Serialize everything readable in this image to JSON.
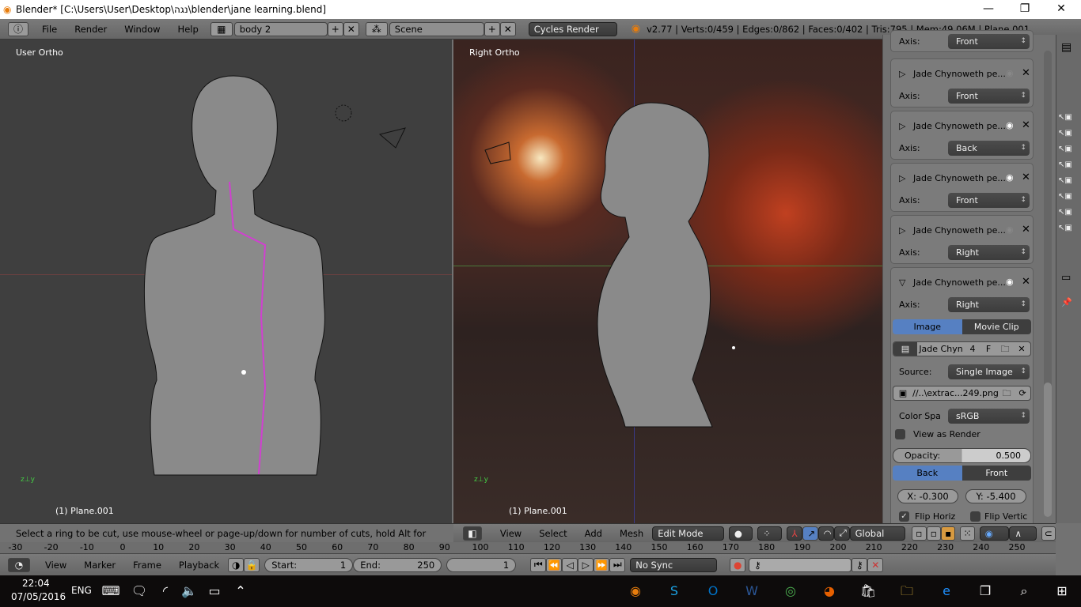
{
  "window": {
    "title": "Blender* [C:\\Users\\User\\Desktop\\נגה\\blender\\jane learning.blend]",
    "minimize": "—",
    "maximize": "❐",
    "close": "✕"
  },
  "header": {
    "menus": [
      "File",
      "Render",
      "Window",
      "Help"
    ],
    "screen": "body 2",
    "scene": "Scene",
    "engine": "Cycles Render",
    "stats": "v2.77 | Verts:0/459 | Edges:0/862 | Faces:0/402 | Tris:795 | Mem:49.06M | Plane.001"
  },
  "viewport_left": {
    "label": "User Ortho",
    "object": "(1) Plane.001"
  },
  "viewport_right": {
    "label": "Right Ortho",
    "object": "(1) Plane.001"
  },
  "properties": {
    "axis_label": "Axis:",
    "top_axis": "Front",
    "backgrounds": [
      {
        "name": "Jade Chynoweth pe...",
        "axis": "Front",
        "visible": false,
        "expanded": false
      },
      {
        "name": "Jade Chynoweth pe...",
        "axis": "Back",
        "visible": true,
        "expanded": false
      },
      {
        "name": "Jade Chynoweth pe...",
        "axis": "Front",
        "visible": true,
        "expanded": false
      },
      {
        "name": "Jade Chynoweth pe...",
        "axis": "Right",
        "visible": false,
        "expanded": false
      },
      {
        "name": "Jade Chynoweth pe...",
        "axis": "Right",
        "visible": true,
        "expanded": true
      }
    ],
    "source_tabs": [
      "Image",
      "Movie Clip"
    ],
    "image_name": "Jade Chyn",
    "users": "4",
    "fake": "F",
    "source_label": "Source:",
    "source": "Single Image",
    "filepath": "//..\\extrac...249.png",
    "colorspace_label": "Color Spa",
    "colorspace": "sRGB",
    "view_as_render": "View as Render",
    "opacity_label": "Opacity:",
    "opacity": "0.500",
    "depth_tabs": [
      "Back",
      "Front"
    ],
    "x": "X: -0.300",
    "y": "Y: -5.400",
    "flip_h": "Flip Horiz",
    "flip_v": "Flip Vertic"
  },
  "status": "Select a ring to be cut, use mouse-wheel or page-up/down for number of cuts, hold Alt for smooth",
  "header3d": {
    "menus": [
      "View",
      "Select",
      "Add",
      "Mesh"
    ],
    "mode": "Edit Mode",
    "orientation": "Global"
  },
  "ruler": [
    "-30",
    "-20",
    "-10",
    "0",
    "10",
    "20",
    "30",
    "40",
    "50",
    "60",
    "70",
    "80",
    "90",
    "100",
    "110",
    "120",
    "130",
    "140",
    "150",
    "160",
    "170",
    "180",
    "190",
    "200",
    "210",
    "220",
    "230",
    "240",
    "250"
  ],
  "timeline": {
    "menus": [
      "View",
      "Marker",
      "Frame",
      "Playback"
    ],
    "start": "Start:",
    "start_val": "1",
    "end": "End:",
    "end_val": "250",
    "current": "1",
    "sync": "No Sync"
  },
  "taskbar": {
    "time": "22:04",
    "date": "07/05/2016",
    "lang": "ENG"
  },
  "colors": {
    "accent": "#5680c2",
    "header": "#727272",
    "viewport": "#3f3f3f"
  }
}
